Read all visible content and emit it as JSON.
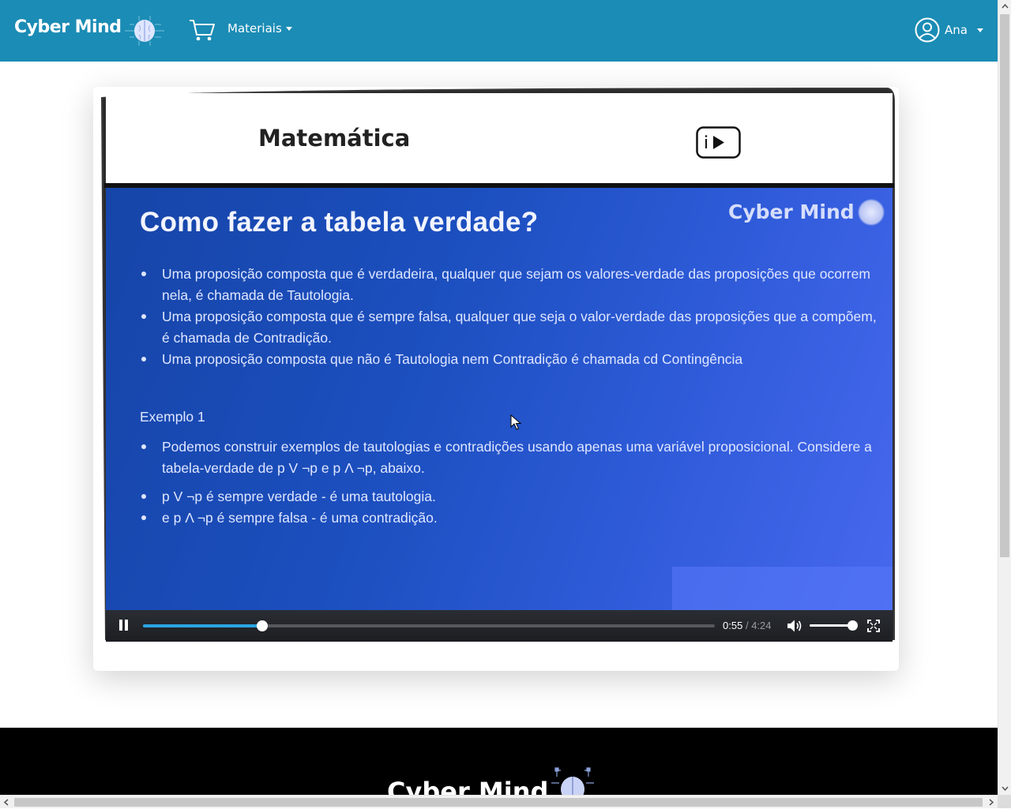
{
  "navbar": {
    "brand": "Cyber Mind",
    "materiais_label": "Materiais",
    "user_name": "Ana"
  },
  "card": {
    "title": "Matemática"
  },
  "slide": {
    "title": "Como fazer a tabela verdade?",
    "brand": "Cyber Mind",
    "bullets_intro": [
      "Uma proposição composta que é verdadeira, qualquer que sejam os valores-verdade das proposições que ocorrem nela, é chamada de Tautologia.",
      "Uma proposição composta que é sempre falsa, qualquer que seja o valor-verdade das proposições que a compõem, é chamada de Contradição.",
      "Uma proposição composta que não é Tautologia nem Contradição é chamada cd Contingência"
    ],
    "example_heading": "Exemplo 1",
    "bullets_example": [
      "Podemos construir exemplos de tautologias e contradições usando apenas uma variável proposicional. Considere a tabela-verdade de p V ¬p e p Λ ¬p, abaixo."
    ],
    "bullets_conclusion": [
      "p V ¬p é sempre verdade - é uma tautologia.",
      "e p Λ ¬p é sempre falsa - é uma contradição."
    ]
  },
  "player": {
    "current_time": "0:55",
    "separator": "/",
    "duration": "4:24",
    "progress_fraction": 0.2083,
    "volume_fraction": 1.0
  },
  "footer": {
    "brand": "Cyber Mind"
  },
  "colors": {
    "navbar": "#1b8cb5",
    "progress": "#2aa4e0",
    "footer": "#000000"
  },
  "icons": {
    "cart": "cart-icon",
    "user": "user-circle-icon",
    "youtube": "youtube-play-icon",
    "pause": "pause-icon",
    "volume": "volume-icon",
    "fullscreen": "fullscreen-icon"
  }
}
